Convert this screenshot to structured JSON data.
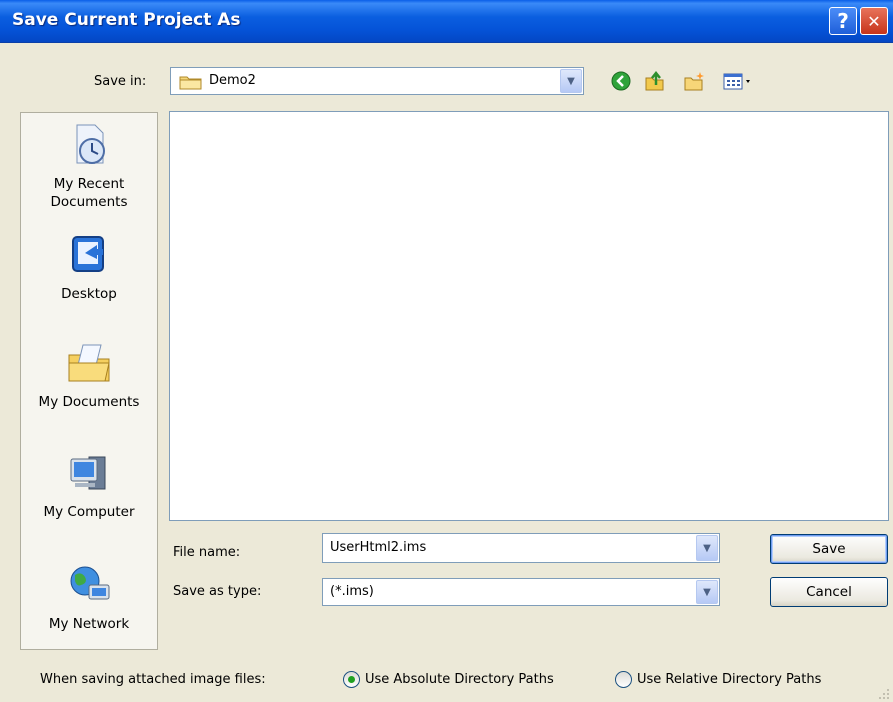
{
  "window": {
    "title": "Save Current Project As",
    "help_glyph": "?",
    "close_glyph": "✕"
  },
  "save_in": {
    "label": "Save in:",
    "value": "Demo2"
  },
  "places": [
    {
      "label_line1": "My Recent",
      "label_line2": "Documents",
      "icon": "recent-documents-icon"
    },
    {
      "label_line1": "Desktop",
      "label_line2": "",
      "icon": "desktop-icon"
    },
    {
      "label_line1": "My Documents",
      "label_line2": "",
      "icon": "my-documents-icon"
    },
    {
      "label_line1": "My Computer",
      "label_line2": "",
      "icon": "my-computer-icon"
    },
    {
      "label_line1": "My Network",
      "label_line2": "",
      "icon": "my-network-icon"
    }
  ],
  "file_name": {
    "label": "File name:",
    "value": "UserHtml2.ims"
  },
  "save_as_type": {
    "label": "Save as type:",
    "value": "(*.ims)"
  },
  "buttons": {
    "save": "Save",
    "cancel": "Cancel"
  },
  "image_paths": {
    "label": "When saving attached image files:",
    "option_absolute": "Use Absolute Directory Paths",
    "option_relative": "Use Relative Directory Paths",
    "selected": "absolute"
  },
  "colors": {
    "title_bar": "#0553d8",
    "dialog_bg": "#ece9d8",
    "field_border": "#7f9db9"
  }
}
